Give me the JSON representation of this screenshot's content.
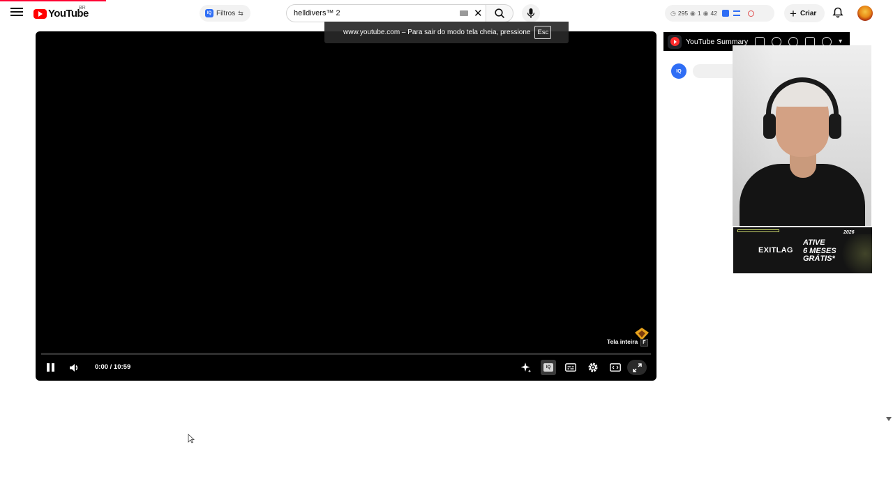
{
  "header": {
    "logo_text": "YouTube",
    "logo_country": "BR",
    "filters_label": "Filtros",
    "filters_badge": "IQ",
    "search_value": "helldivers™ 2",
    "stats": {
      "a": "295",
      "b": "1",
      "c": "42"
    },
    "create_label": "Criar"
  },
  "fullscreen_notice": {
    "text": "www.youtube.com – Para sair do modo tela cheia, pressione",
    "key": "Esc"
  },
  "player": {
    "time_display": "0:00 / 10:59",
    "fullscreen_tooltip": "Tela inteira",
    "fullscreen_key": "F",
    "iq_label": "IQ"
  },
  "sidebar": {
    "summary_title": "YouTube Summary",
    "iq_label": "IQ"
  },
  "ad": {
    "brand": "EXITLAG",
    "line1": "ATIVE",
    "line2": "6 MESES",
    "line3": "GRÁTIS*",
    "year": "2026"
  },
  "colors": {
    "brand_red": "#ff0000",
    "iq_blue": "#2f6ef5",
    "ad_accent": "#c8d46a"
  }
}
